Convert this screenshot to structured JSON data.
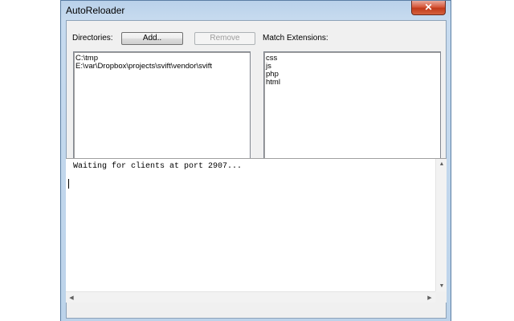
{
  "window": {
    "title": "AutoReloader",
    "close_glyph": "✕"
  },
  "directories": {
    "label": "Directories:",
    "add_label": "Add..",
    "remove_label": "Remove",
    "items": [
      "C:\\tmp",
      "E:\\var\\Dropbox\\projects\\svift\\vendor\\svift"
    ]
  },
  "extensions": {
    "label": "Match Extensions:",
    "items": [
      "css",
      "js",
      "php",
      "html"
    ]
  },
  "console": {
    "text": "Waiting for clients at port 2907..."
  },
  "scrollbar": {
    "up": "▲",
    "down": "▼",
    "left": "◀",
    "right": "▶"
  }
}
